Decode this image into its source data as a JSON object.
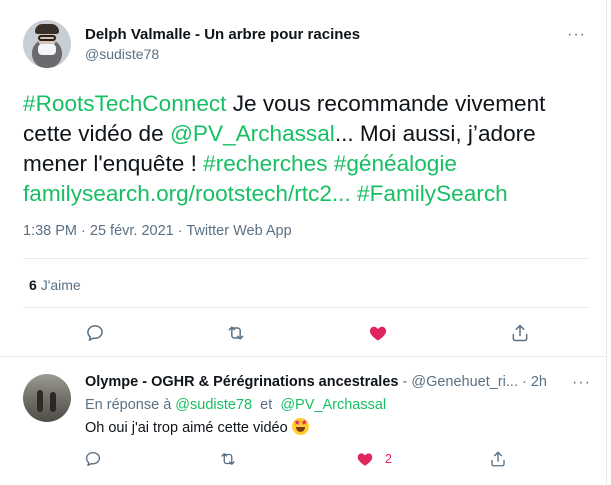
{
  "tweet": {
    "author_name": "Delph Valmalle - Un arbre pour racines",
    "author_handle": "@sudiste78",
    "body": {
      "hashtag1": "#RootsTechConnect",
      "text1": " Je vous recommande vivement cette vidéo de ",
      "mention": "@PV_Archassal",
      "text2": "... Moi aussi, j’adore mener l'enquête ! ",
      "hashtag2": "#recherches",
      "space1": " ",
      "hashtag3": "#généalogie",
      "link": "familysearch.org/rootstech/rtc2...",
      "space2": " ",
      "hashtag4": "#FamilySearch"
    },
    "timestamp": "1:38 PM · 25 févr. 2021 · Twitter Web App",
    "likes_count": "6",
    "likes_label": "J'aime",
    "more_label": "···"
  },
  "reply": {
    "author_name": "Olympe - OGHR & Pérégrinations ancestrales",
    "author_handle": " - @Genehuet_ri...",
    "time": " · 2h",
    "in_reply_prefix": "En réponse à ",
    "in_reply_to_1": "@sudiste78",
    "in_reply_and": "  et  ",
    "in_reply_to_2": "@PV_Archassal",
    "text": "Oh oui j'ai trop aimé cette vidéo",
    "like_count": "2",
    "more_label": "···"
  },
  "colors": {
    "link": "#17bf63",
    "like": "#e0245e",
    "secondary": "#5b7083",
    "divider": "#e6ecf0"
  },
  "icons": [
    "reply-icon",
    "retweet-icon",
    "like-icon",
    "share-icon",
    "more-icon",
    "star-struck-emoji"
  ]
}
